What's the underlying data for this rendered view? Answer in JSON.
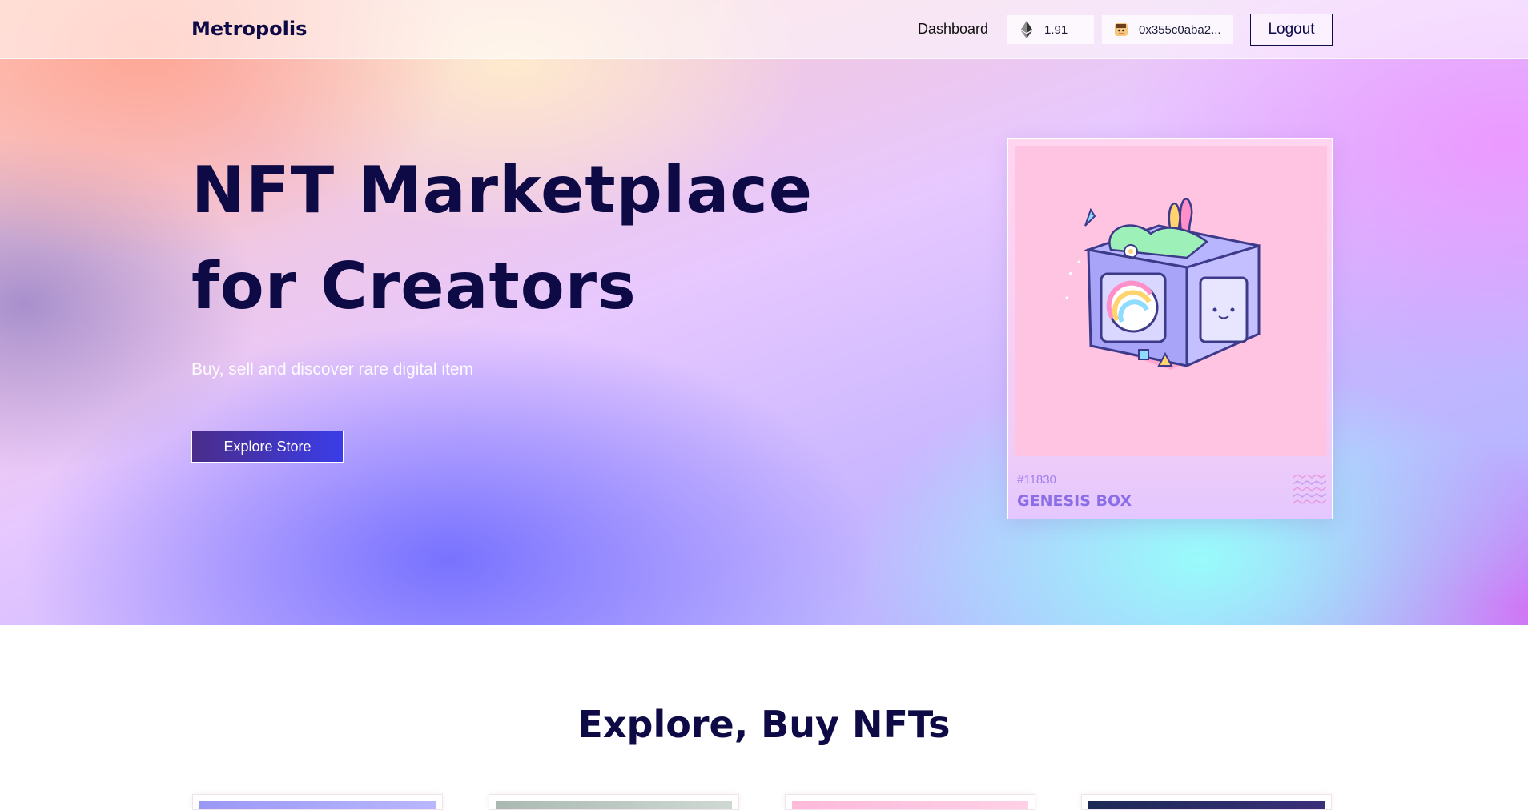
{
  "navbar": {
    "brand": "Metropolis",
    "dashboard_link": "Dashboard",
    "eth_balance": "1.91",
    "wallet_address": "0x355c0aba2...",
    "logout_label": "Logout",
    "icons": [
      "ethereum-icon",
      "avatar"
    ]
  },
  "hero": {
    "title_line1": "NFT Marketplace",
    "title_line2": "for Creators",
    "subtitle": "Buy, sell and discover rare digital item",
    "cta_label": "Explore Store"
  },
  "featured_nft": {
    "token_id": "#11830",
    "name": "GENESIS BOX"
  },
  "explore_section": {
    "title": "Explore, Buy NFTs",
    "card_count_visible": 4
  },
  "colors": {
    "primary_text": "#0d0a46",
    "button_gradient_start": "#4a2c8a",
    "button_gradient_end": "#3b3de8",
    "nft_accent": "#8b6ee6"
  }
}
